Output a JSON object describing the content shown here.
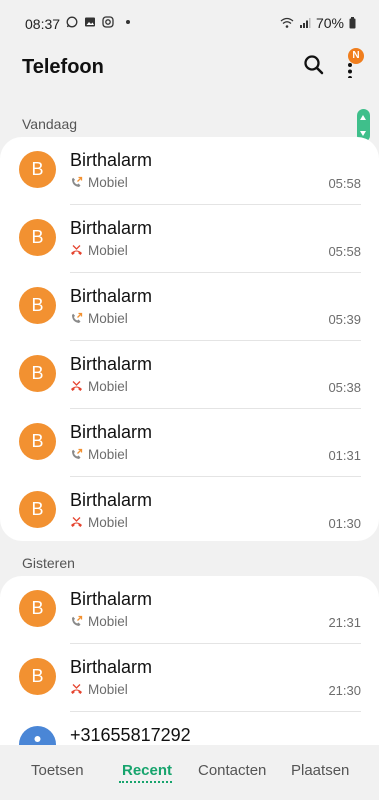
{
  "status_bar": {
    "time": "08:37",
    "battery_percent": "70%",
    "icons": [
      "whatsapp-icon",
      "gallery-icon",
      "instagram-icon",
      "wifi-calling-icon",
      "signal-icon",
      "battery-icon"
    ]
  },
  "app_bar": {
    "title": "Telefoon",
    "badge": "N"
  },
  "sections": [
    {
      "label": "Vandaag",
      "calls": [
        {
          "initial": "B",
          "name": "Birthalarm",
          "type": "Mobiel",
          "status": "outgoing",
          "time": "05:58"
        },
        {
          "initial": "B",
          "name": "Birthalarm",
          "type": "Mobiel",
          "status": "missed",
          "time": "05:58"
        },
        {
          "initial": "B",
          "name": "Birthalarm",
          "type": "Mobiel",
          "status": "outgoing",
          "time": "05:39"
        },
        {
          "initial": "B",
          "name": "Birthalarm",
          "type": "Mobiel",
          "status": "missed",
          "time": "05:38"
        },
        {
          "initial": "B",
          "name": "Birthalarm",
          "type": "Mobiel",
          "status": "outgoing",
          "time": "01:31"
        },
        {
          "initial": "B",
          "name": "Birthalarm",
          "type": "Mobiel",
          "status": "missed",
          "time": "01:30"
        }
      ]
    },
    {
      "label": "Gisteren",
      "calls": [
        {
          "initial": "B",
          "name": "Birthalarm",
          "type": "Mobiel",
          "status": "outgoing",
          "time": "21:31"
        },
        {
          "initial": "B",
          "name": "Birthalarm",
          "type": "Mobiel",
          "status": "missed",
          "time": "21:30"
        },
        {
          "initial": "",
          "name": "+31655817292",
          "type": "",
          "status": "",
          "time": ""
        }
      ]
    }
  ],
  "bottom_nav": {
    "tabs": [
      "Toetsen",
      "Recent",
      "Contacten",
      "Plaatsen"
    ],
    "active": "Recent"
  },
  "colors": {
    "avatar": "#f29131",
    "avatar_unknown": "#4a86d6",
    "accent": "#17a46d",
    "missed": "#e5442f",
    "badge": "#f07e1e"
  }
}
